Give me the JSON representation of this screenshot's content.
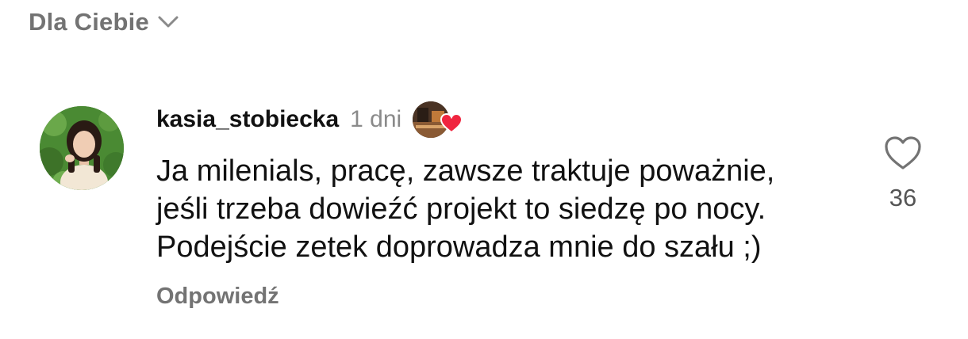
{
  "header": {
    "sort_label": "Dla Ciebie",
    "sort_icon": "chevron-down-icon"
  },
  "comment": {
    "username": "kasia_stobiecka",
    "timestamp": "1 dni",
    "author_liked_icon": "heart-filled-icon",
    "text_lines": [
      "Ja milenials, pracę, zawsze traktuje poważnie,",
      "jeśli trzeba dowieźć projekt to siedzę po nocy.",
      "Podejście zetek doprowadza mnie do szału ;)"
    ],
    "reply_label": "Odpowiedź",
    "like_icon": "heart-outline-icon",
    "like_count": "36"
  },
  "colors": {
    "muted_text": "#737373",
    "timestamp_text": "#8a8a8a",
    "author_heart": "#f0253f",
    "like_count": "#555555"
  }
}
